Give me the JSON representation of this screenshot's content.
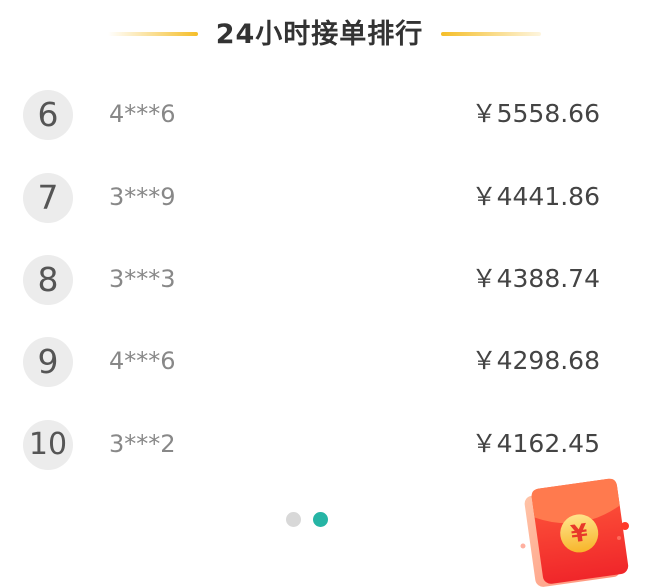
{
  "header": {
    "title": "24小时接单排行"
  },
  "ranking": [
    {
      "rank": "6",
      "user": "4***6",
      "amount": "￥5558.66"
    },
    {
      "rank": "7",
      "user": "3***9",
      "amount": "￥4441.86"
    },
    {
      "rank": "8",
      "user": "3***3",
      "amount": "￥4388.74"
    },
    {
      "rank": "9",
      "user": "4***6",
      "amount": "￥4298.68"
    },
    {
      "rank": "10",
      "user": "3***2",
      "amount": "￥4162.45"
    }
  ],
  "pagination": {
    "active_index": 2,
    "total": 2,
    "inactive_color": "#d8d8d8",
    "active_color": "#26b5a5"
  },
  "red_packet": {
    "icon": "red-envelope-icon",
    "symbol": "¥"
  },
  "colors": {
    "accent_line": "#f5be28",
    "badge_bg": "#ececec",
    "red_envelope": "#f23a2a"
  }
}
